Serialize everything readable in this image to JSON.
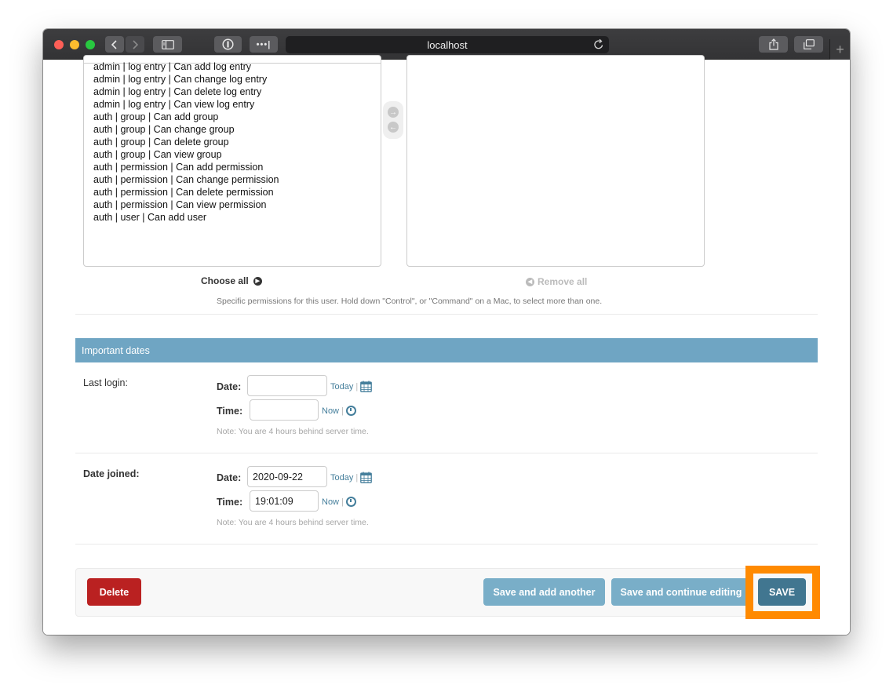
{
  "browser": {
    "url": "localhost"
  },
  "permissions": {
    "available": [
      "admin | log entry | Can add log entry",
      "admin | log entry | Can change log entry",
      "admin | log entry | Can delete log entry",
      "admin | log entry | Can view log entry",
      "auth | group | Can add group",
      "auth | group | Can change group",
      "auth | group | Can delete group",
      "auth | group | Can view group",
      "auth | permission | Can add permission",
      "auth | permission | Can change permission",
      "auth | permission | Can delete permission",
      "auth | permission | Can view permission",
      "auth | user | Can add user"
    ],
    "choose_all": "Choose all",
    "remove_all": "Remove all",
    "help": "Specific permissions for this user. Hold down \"Control\", or \"Command\" on a Mac, to select more than one."
  },
  "important_dates": {
    "title": "Important dates",
    "last_login": {
      "label": "Last login:",
      "date_label": "Date:",
      "date_value": "",
      "today": "Today",
      "time_label": "Time:",
      "time_value": "",
      "now": "Now",
      "note": "Note: You are 4 hours behind server time."
    },
    "date_joined": {
      "label": "Date joined:",
      "date_label": "Date:",
      "date_value": "2020-09-22",
      "today": "Today",
      "time_label": "Time:",
      "time_value": "19:01:09",
      "now": "Now",
      "note": "Note: You are 4 hours behind server time."
    }
  },
  "submit": {
    "delete": "Delete",
    "save_add_another": "Save and add another",
    "save_continue": "Save and continue editing",
    "save": "SAVE"
  },
  "colors": {
    "module_header": "#6fa5c3",
    "delete": "#ba2121",
    "secondary_button": "#79aec8",
    "primary_button": "#417690",
    "highlight": "#ff8a00"
  }
}
